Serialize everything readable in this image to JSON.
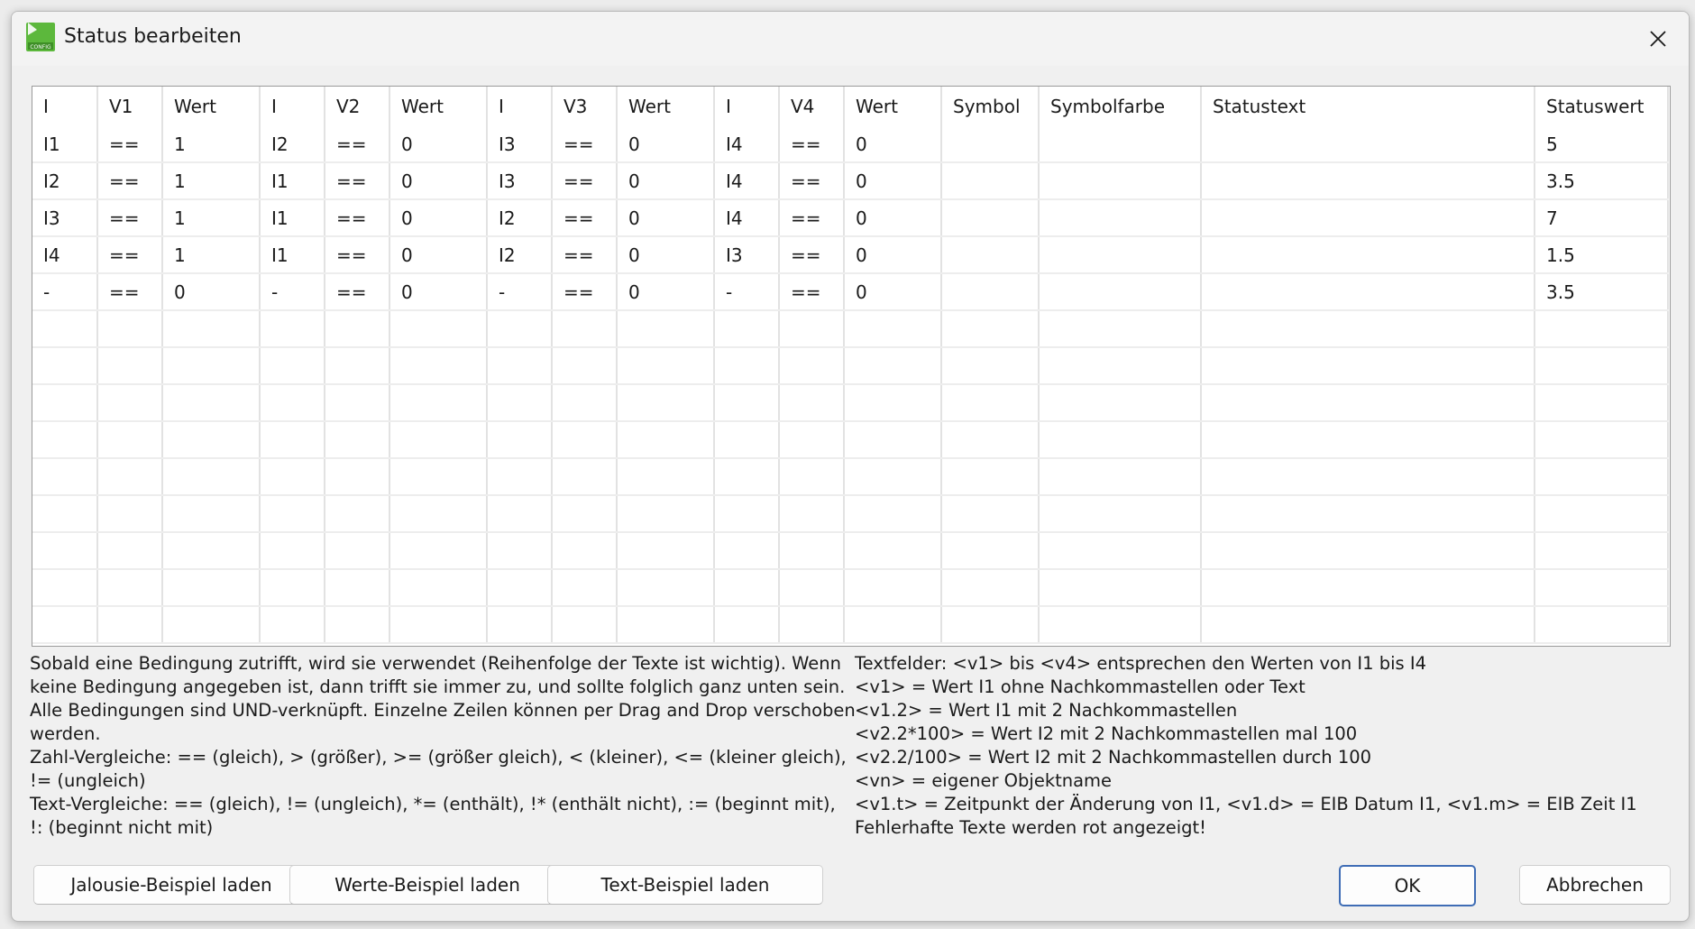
{
  "window": {
    "title": "Status bearbeiten",
    "icon": "config-app-icon",
    "close_icon": "close-icon"
  },
  "table": {
    "columns": [
      "I",
      "V1",
      "Wert",
      "I",
      "V2",
      "Wert",
      "I",
      "V3",
      "Wert",
      "I",
      "V4",
      "Wert",
      "Symbol",
      "Symbolfarbe",
      "Statustext",
      "Statuswert"
    ],
    "rows": [
      [
        "I1",
        "==",
        "1",
        "I2",
        "==",
        "0",
        "I3",
        "==",
        "0",
        "I4",
        "==",
        "0",
        "",
        "",
        "",
        "5"
      ],
      [
        "I2",
        "==",
        "1",
        "I1",
        "==",
        "0",
        "I3",
        "==",
        "0",
        "I4",
        "==",
        "0",
        "",
        "",
        "",
        "3.5"
      ],
      [
        "I3",
        "==",
        "1",
        "I1",
        "==",
        "0",
        "I2",
        "==",
        "0",
        "I4",
        "==",
        "0",
        "",
        "",
        "",
        "7"
      ],
      [
        "I4",
        "==",
        "1",
        "I1",
        "==",
        "0",
        "I2",
        "==",
        "0",
        "I3",
        "==",
        "0",
        "",
        "",
        "",
        "1.5"
      ],
      [
        "-",
        "==",
        "0",
        "-",
        "==",
        "0",
        "-",
        "==",
        "0",
        "-",
        "==",
        "0",
        "",
        "",
        "",
        "3.5"
      ],
      [
        "",
        "",
        "",
        "",
        "",
        "",
        "",
        "",
        "",
        "",
        "",
        "",
        "",
        "",
        "",
        ""
      ],
      [
        "",
        "",
        "",
        "",
        "",
        "",
        "",
        "",
        "",
        "",
        "",
        "",
        "",
        "",
        "",
        ""
      ],
      [
        "",
        "",
        "",
        "",
        "",
        "",
        "",
        "",
        "",
        "",
        "",
        "",
        "",
        "",
        "",
        ""
      ],
      [
        "",
        "",
        "",
        "",
        "",
        "",
        "",
        "",
        "",
        "",
        "",
        "",
        "",
        "",
        "",
        ""
      ],
      [
        "",
        "",
        "",
        "",
        "",
        "",
        "",
        "",
        "",
        "",
        "",
        "",
        "",
        "",
        "",
        ""
      ],
      [
        "",
        "",
        "",
        "",
        "",
        "",
        "",
        "",
        "",
        "",
        "",
        "",
        "",
        "",
        "",
        ""
      ],
      [
        "",
        "",
        "",
        "",
        "",
        "",
        "",
        "",
        "",
        "",
        "",
        "",
        "",
        "",
        "",
        ""
      ],
      [
        "",
        "",
        "",
        "",
        "",
        "",
        "",
        "",
        "",
        "",
        "",
        "",
        "",
        "",
        "",
        ""
      ],
      [
        "",
        "",
        "",
        "",
        "",
        "",
        "",
        "",
        "",
        "",
        "",
        "",
        "",
        "",
        "",
        ""
      ]
    ]
  },
  "help_left": [
    "Sobald eine Bedingung zutrifft, wird sie verwendet (Reihenfolge der Texte ist wichtig). Wenn",
    "keine Bedingung angegeben ist, dann trifft sie immer zu, und sollte folglich ganz unten sein.",
    "Alle Bedingungen sind UND-verknüpft. Einzelne Zeilen können per Drag and Drop verschoben",
    "werden.",
    "Zahl-Vergleiche: == (gleich), > (größer), >= (größer gleich), < (kleiner), <= (kleiner gleich),",
    "!= (ungleich)",
    "Text-Vergleiche: == (gleich), != (ungleich), *= (enthält), !* (enthält nicht), := (beginnt mit),",
    "!: (beginnt nicht mit)"
  ],
  "help_right": [
    "Textfelder: <v1> bis <v4> entsprechen den Werten von I1 bis I4",
    "<v1> = Wert I1 ohne Nachkommastellen oder Text",
    "<v1.2> = Wert I1 mit 2 Nachkommastellen",
    "<v2.2*100> = Wert I2 mit 2 Nachkommastellen mal 100",
    "<v2.2/100> = Wert I2 mit 2 Nachkommastellen durch 100",
    "<vn> = eigener Objektname",
    "<v1.t> = Zeitpunkt der Änderung von I1, <v1.d> = EIB Datum I1, <v1.m> = EIB Zeit I1",
    "Fehlerhafte Texte werden rot angezeigt!"
  ],
  "buttons": {
    "jalousie": "Jalousie-Beispiel laden",
    "werte": "Werte-Beispiel laden",
    "text": "Text-Beispiel laden",
    "ok": "OK",
    "cancel": "Abbrechen"
  },
  "colors": {
    "accent": "#3f6db5",
    "icon_green": "#5cb83c"
  }
}
